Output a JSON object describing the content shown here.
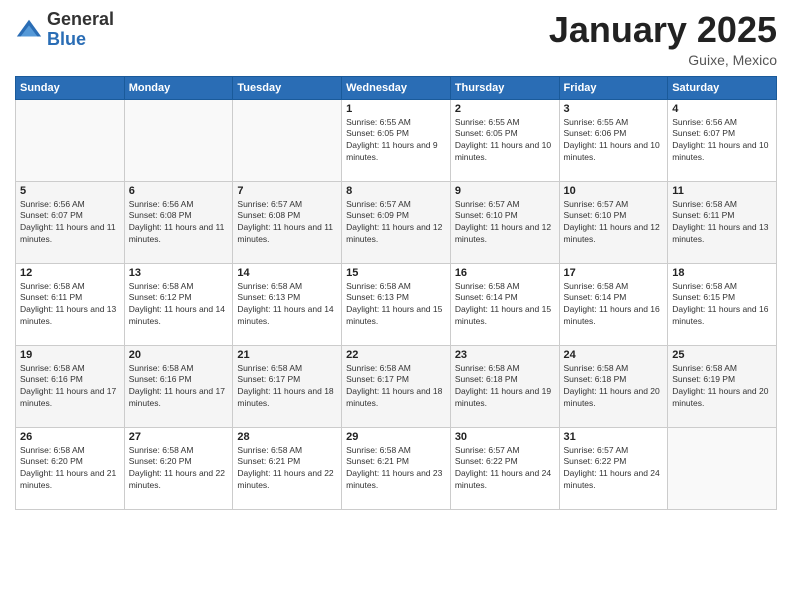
{
  "logo": {
    "general": "General",
    "blue": "Blue"
  },
  "title": "January 2025",
  "subtitle": "Guixe, Mexico",
  "headers": [
    "Sunday",
    "Monday",
    "Tuesday",
    "Wednesday",
    "Thursday",
    "Friday",
    "Saturday"
  ],
  "weeks": [
    [
      {
        "day": "",
        "info": ""
      },
      {
        "day": "",
        "info": ""
      },
      {
        "day": "",
        "info": ""
      },
      {
        "day": "1",
        "info": "Sunrise: 6:55 AM\nSunset: 6:05 PM\nDaylight: 11 hours and 9 minutes."
      },
      {
        "day": "2",
        "info": "Sunrise: 6:55 AM\nSunset: 6:05 PM\nDaylight: 11 hours and 10 minutes."
      },
      {
        "day": "3",
        "info": "Sunrise: 6:55 AM\nSunset: 6:06 PM\nDaylight: 11 hours and 10 minutes."
      },
      {
        "day": "4",
        "info": "Sunrise: 6:56 AM\nSunset: 6:07 PM\nDaylight: 11 hours and 10 minutes."
      }
    ],
    [
      {
        "day": "5",
        "info": "Sunrise: 6:56 AM\nSunset: 6:07 PM\nDaylight: 11 hours and 11 minutes."
      },
      {
        "day": "6",
        "info": "Sunrise: 6:56 AM\nSunset: 6:08 PM\nDaylight: 11 hours and 11 minutes."
      },
      {
        "day": "7",
        "info": "Sunrise: 6:57 AM\nSunset: 6:08 PM\nDaylight: 11 hours and 11 minutes."
      },
      {
        "day": "8",
        "info": "Sunrise: 6:57 AM\nSunset: 6:09 PM\nDaylight: 11 hours and 12 minutes."
      },
      {
        "day": "9",
        "info": "Sunrise: 6:57 AM\nSunset: 6:10 PM\nDaylight: 11 hours and 12 minutes."
      },
      {
        "day": "10",
        "info": "Sunrise: 6:57 AM\nSunset: 6:10 PM\nDaylight: 11 hours and 12 minutes."
      },
      {
        "day": "11",
        "info": "Sunrise: 6:58 AM\nSunset: 6:11 PM\nDaylight: 11 hours and 13 minutes."
      }
    ],
    [
      {
        "day": "12",
        "info": "Sunrise: 6:58 AM\nSunset: 6:11 PM\nDaylight: 11 hours and 13 minutes."
      },
      {
        "day": "13",
        "info": "Sunrise: 6:58 AM\nSunset: 6:12 PM\nDaylight: 11 hours and 14 minutes."
      },
      {
        "day": "14",
        "info": "Sunrise: 6:58 AM\nSunset: 6:13 PM\nDaylight: 11 hours and 14 minutes."
      },
      {
        "day": "15",
        "info": "Sunrise: 6:58 AM\nSunset: 6:13 PM\nDaylight: 11 hours and 15 minutes."
      },
      {
        "day": "16",
        "info": "Sunrise: 6:58 AM\nSunset: 6:14 PM\nDaylight: 11 hours and 15 minutes."
      },
      {
        "day": "17",
        "info": "Sunrise: 6:58 AM\nSunset: 6:14 PM\nDaylight: 11 hours and 16 minutes."
      },
      {
        "day": "18",
        "info": "Sunrise: 6:58 AM\nSunset: 6:15 PM\nDaylight: 11 hours and 16 minutes."
      }
    ],
    [
      {
        "day": "19",
        "info": "Sunrise: 6:58 AM\nSunset: 6:16 PM\nDaylight: 11 hours and 17 minutes."
      },
      {
        "day": "20",
        "info": "Sunrise: 6:58 AM\nSunset: 6:16 PM\nDaylight: 11 hours and 17 minutes."
      },
      {
        "day": "21",
        "info": "Sunrise: 6:58 AM\nSunset: 6:17 PM\nDaylight: 11 hours and 18 minutes."
      },
      {
        "day": "22",
        "info": "Sunrise: 6:58 AM\nSunset: 6:17 PM\nDaylight: 11 hours and 18 minutes."
      },
      {
        "day": "23",
        "info": "Sunrise: 6:58 AM\nSunset: 6:18 PM\nDaylight: 11 hours and 19 minutes."
      },
      {
        "day": "24",
        "info": "Sunrise: 6:58 AM\nSunset: 6:18 PM\nDaylight: 11 hours and 20 minutes."
      },
      {
        "day": "25",
        "info": "Sunrise: 6:58 AM\nSunset: 6:19 PM\nDaylight: 11 hours and 20 minutes."
      }
    ],
    [
      {
        "day": "26",
        "info": "Sunrise: 6:58 AM\nSunset: 6:20 PM\nDaylight: 11 hours and 21 minutes."
      },
      {
        "day": "27",
        "info": "Sunrise: 6:58 AM\nSunset: 6:20 PM\nDaylight: 11 hours and 22 minutes."
      },
      {
        "day": "28",
        "info": "Sunrise: 6:58 AM\nSunset: 6:21 PM\nDaylight: 11 hours and 22 minutes."
      },
      {
        "day": "29",
        "info": "Sunrise: 6:58 AM\nSunset: 6:21 PM\nDaylight: 11 hours and 23 minutes."
      },
      {
        "day": "30",
        "info": "Sunrise: 6:57 AM\nSunset: 6:22 PM\nDaylight: 11 hours and 24 minutes."
      },
      {
        "day": "31",
        "info": "Sunrise: 6:57 AM\nSunset: 6:22 PM\nDaylight: 11 hours and 24 minutes."
      },
      {
        "day": "",
        "info": ""
      }
    ]
  ]
}
